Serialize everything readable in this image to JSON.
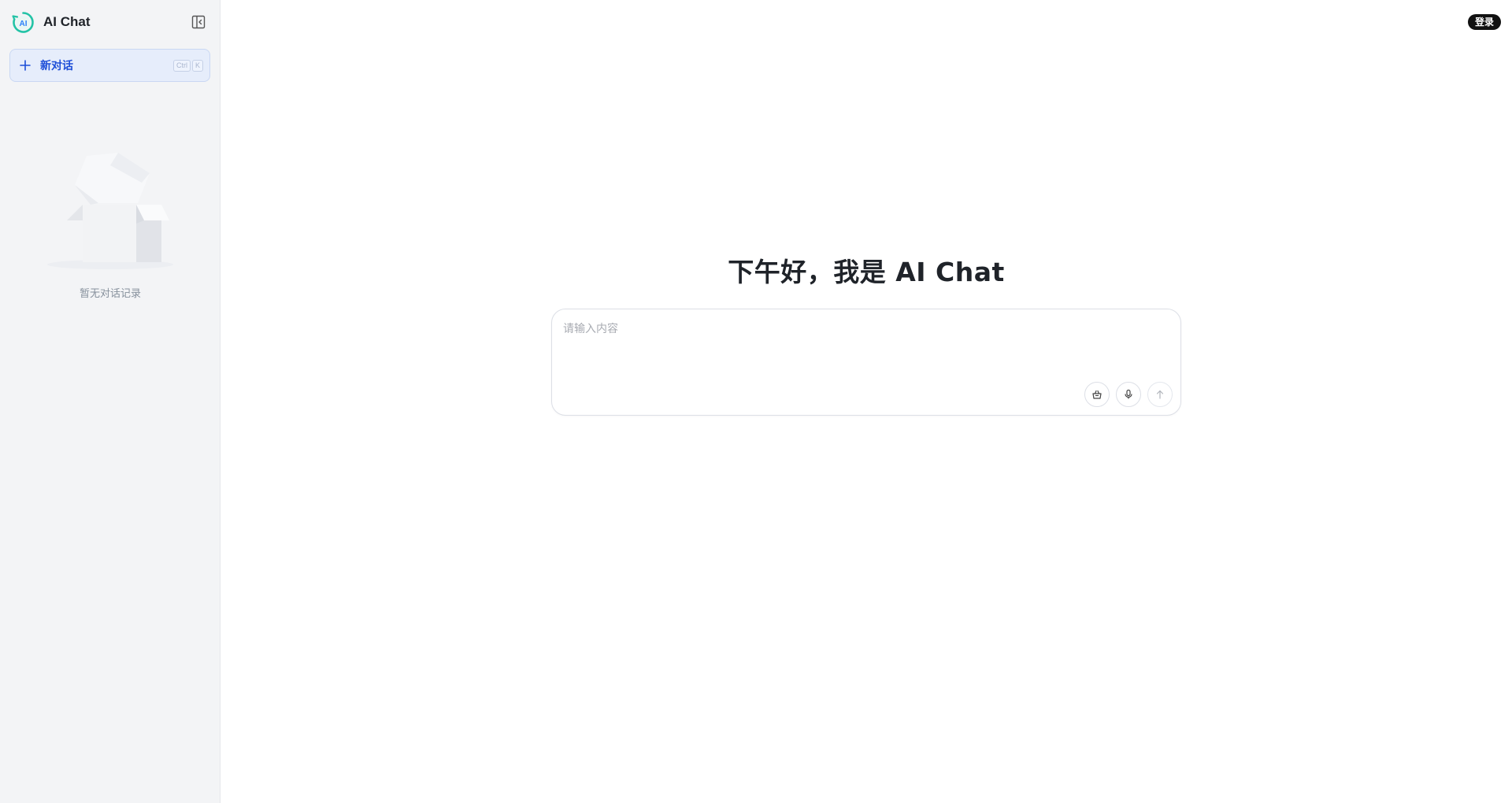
{
  "app": {
    "name": "AI Chat",
    "logo_text": "AI",
    "accent_color": "#1d4ed8",
    "logo_colors": [
      "#23c3a6",
      "#2d7ff9"
    ]
  },
  "sidebar": {
    "new_chat_label": "新对话",
    "shortcut_keys": [
      "Ctrl",
      "K"
    ],
    "empty_text": "暂无对话记录",
    "icons": {
      "collapse": "sidebar-collapse-icon",
      "new_chat": "plus-icon",
      "empty": "empty-box-illustration"
    }
  },
  "header": {
    "login_label": "登录"
  },
  "main": {
    "greeting": "下午好，我是 AI Chat",
    "composer": {
      "placeholder": "请输入内容",
      "value": "",
      "actions": [
        {
          "name": "basket-icon"
        },
        {
          "name": "microphone-icon"
        },
        {
          "name": "arrow-up-icon"
        }
      ]
    }
  }
}
